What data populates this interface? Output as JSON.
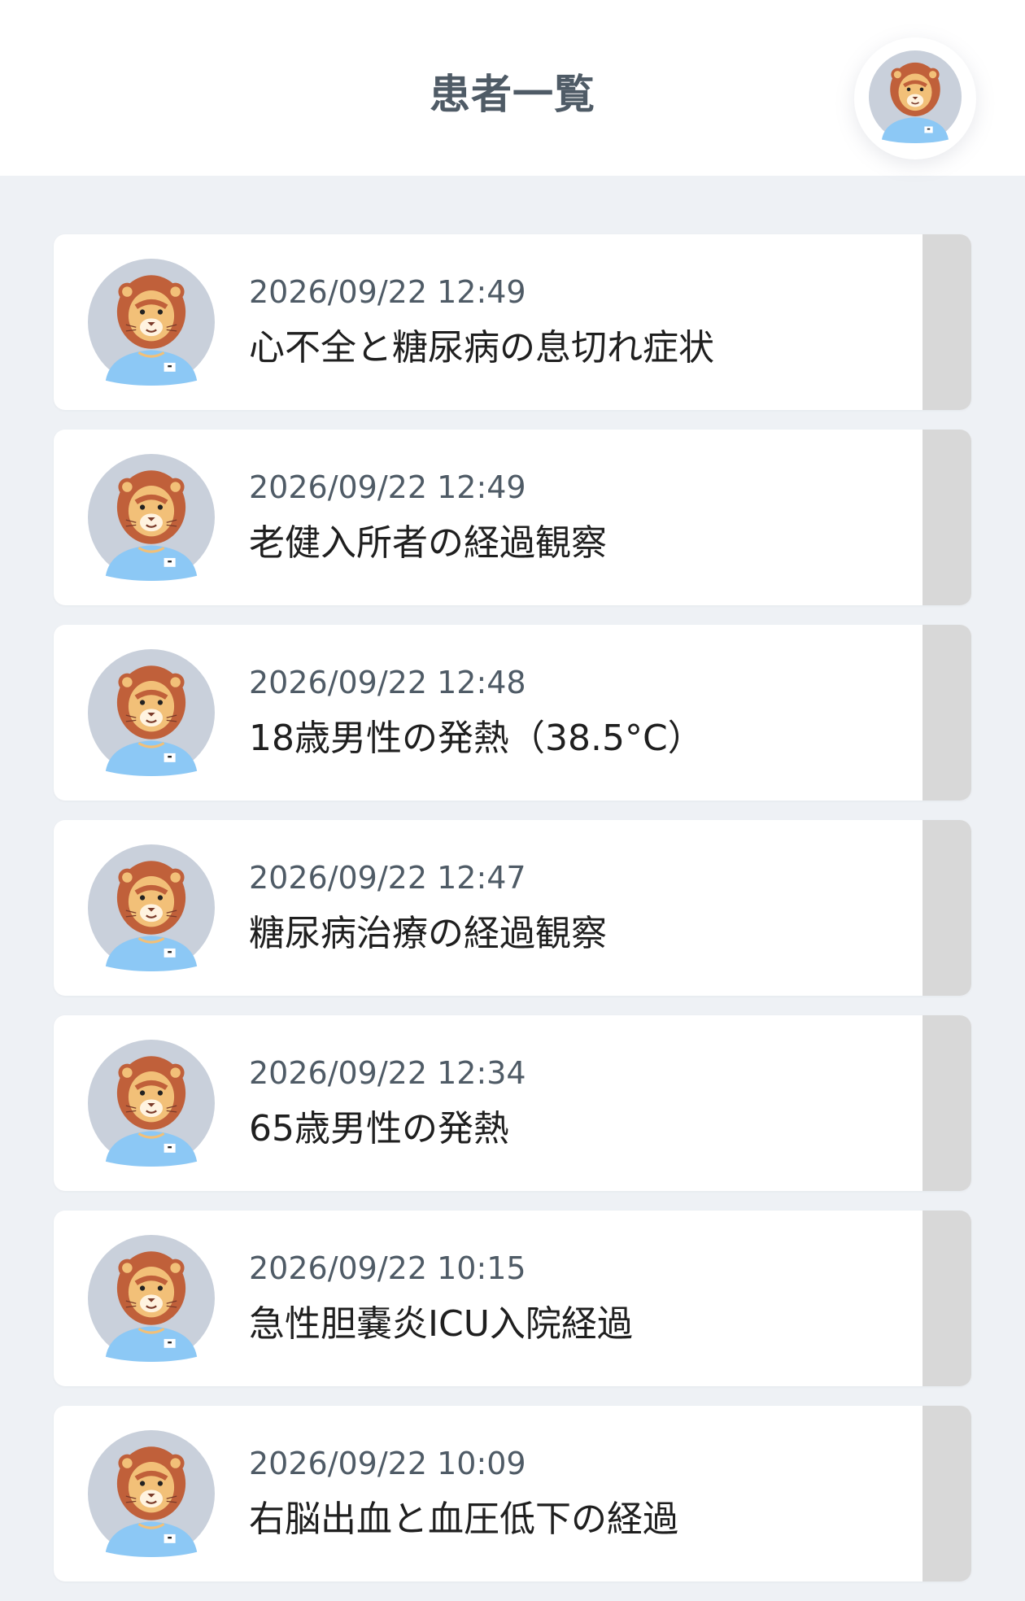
{
  "header": {
    "title": "患者一覧",
    "profile_icon": "lion-doctor-avatar-icon"
  },
  "patients": [
    {
      "time": "2026/09/22 12:49",
      "title": "心不全と糖尿病の息切れ症状"
    },
    {
      "time": "2026/09/22 12:49",
      "title": "老健入所者の経過観察"
    },
    {
      "time": "2026/09/22 12:48",
      "title": "18歳男性の発熱（38.5°C）"
    },
    {
      "time": "2026/09/22 12:47",
      "title": "糖尿病治療の経過観察"
    },
    {
      "time": "2026/09/22 12:34",
      "title": "65歳男性の発熱"
    },
    {
      "time": "2026/09/22 10:15",
      "title": "急性胆嚢炎ICU入院経過"
    },
    {
      "time": "2026/09/22 10:09",
      "title": "右脳出血と血圧低下の経過"
    }
  ],
  "colors": {
    "background": "#eef1f5",
    "card": "#ffffff",
    "card_handle": "#d8d8d8",
    "avatar_bg": "#c9d0db",
    "lion_mane": "#c0603a",
    "lion_face": "#f2c078",
    "shirt": "#8cc8f5"
  }
}
